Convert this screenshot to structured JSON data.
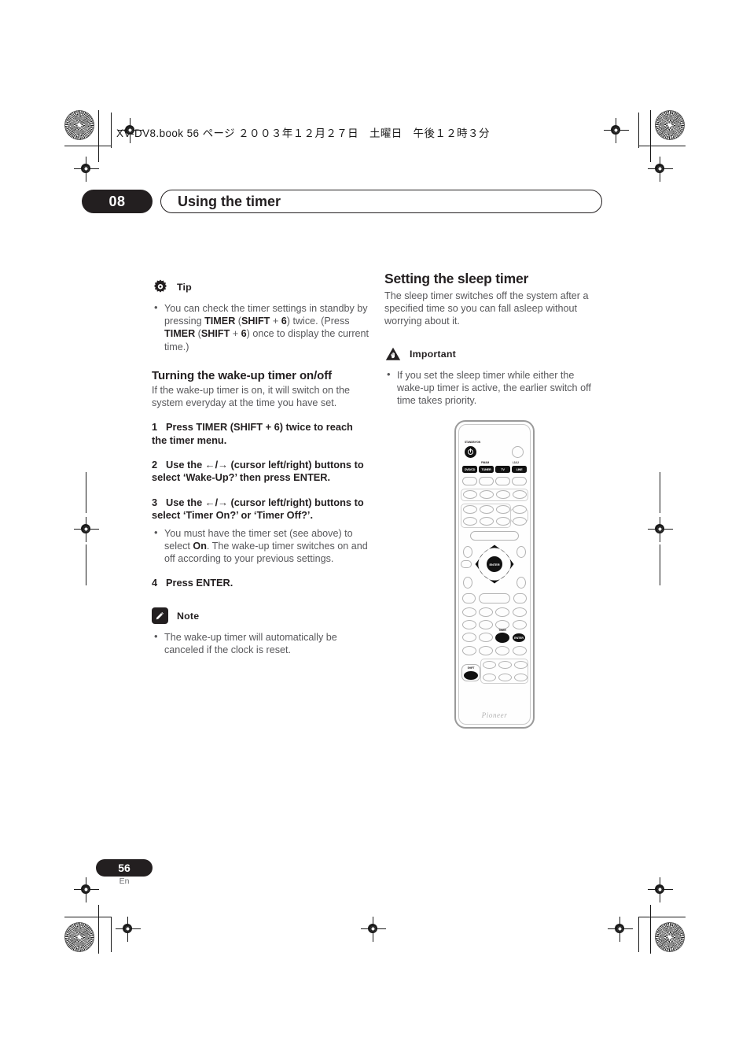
{
  "document": {
    "file_header": "XV-DV8.book  56 ページ  ２００３年１２月２７日　土曜日　午後１２時３分",
    "chapter_number": "08",
    "chapter_title": "Using the timer",
    "page_number": "56",
    "page_language": "En"
  },
  "left_column": {
    "tip": {
      "icon": "tip-gear-icon",
      "label": "Tip",
      "bullets": [
        {
          "runs": [
            {
              "t": "You can check the timer settings in standby by pressing ",
              "b": false
            },
            {
              "t": "TIMER",
              "b": true
            },
            {
              "t": " (",
              "b": false
            },
            {
              "t": "SHIFT",
              "b": true
            },
            {
              "t": " + ",
              "b": false
            },
            {
              "t": "6",
              "b": true
            },
            {
              "t": ") twice. (Press ",
              "b": false
            },
            {
              "t": "TIMER",
              "b": true
            },
            {
              "t": " (",
              "b": false
            },
            {
              "t": "SHIFT",
              "b": true
            },
            {
              "t": " + ",
              "b": false
            },
            {
              "t": "6",
              "b": true
            },
            {
              "t": ") once to display the current time.)",
              "b": false
            }
          ]
        }
      ]
    },
    "section": {
      "heading": "Turning the wake-up timer on/off",
      "intro": "If the wake-up timer is on, it will switch on the system everyday at the time you have set.",
      "steps": [
        {
          "num": "1",
          "text": "Press TIMER (SHIFT + 6) twice to reach the timer menu."
        },
        {
          "num": "2",
          "text": "Use the ←/→ (cursor left/right) buttons to select ‘Wake-Up?’ then press ENTER."
        },
        {
          "num": "3",
          "text": "Use the ←/→ (cursor left/right) buttons to select ‘Timer On?’ or ‘Timer Off?’."
        },
        {
          "num": "4",
          "text": "Press ENTER."
        }
      ],
      "step3_note": {
        "runs": [
          {
            "t": "You must have the timer set (see above) to select ",
            "b": false
          },
          {
            "t": "On",
            "b": true
          },
          {
            "t": ". The wake-up timer switches on and off according to your previous settings.",
            "b": false
          }
        ]
      }
    },
    "note": {
      "icon": "note-pencil-icon",
      "label": "Note",
      "bullets": [
        "The wake-up timer will automatically be canceled if the clock is reset."
      ]
    }
  },
  "right_column": {
    "section": {
      "heading": "Setting the sleep timer",
      "intro": "The sleep timer switches off the system after a specified time so you can fall asleep without worrying about it."
    },
    "important": {
      "icon": "important-warning-icon",
      "label": "Important",
      "bullets": [
        "If you set the sleep timer while either the wake-up timer is active, the earlier switch off time takes priority."
      ]
    },
    "remote": {
      "name": "pioneer-remote-control",
      "brand": "Pioneer",
      "standby_label": "STANDBY/ON",
      "fm_am_label": "FM/AM",
      "line_label": "L1/L2",
      "source_buttons": [
        "DVD/CD",
        "TUNER",
        "TV",
        "LINE"
      ],
      "enter_label": "ENTER",
      "timer_label": "TIMER",
      "keypad_enter_label": "ENTER",
      "shift_label": "SHIFT"
    }
  }
}
